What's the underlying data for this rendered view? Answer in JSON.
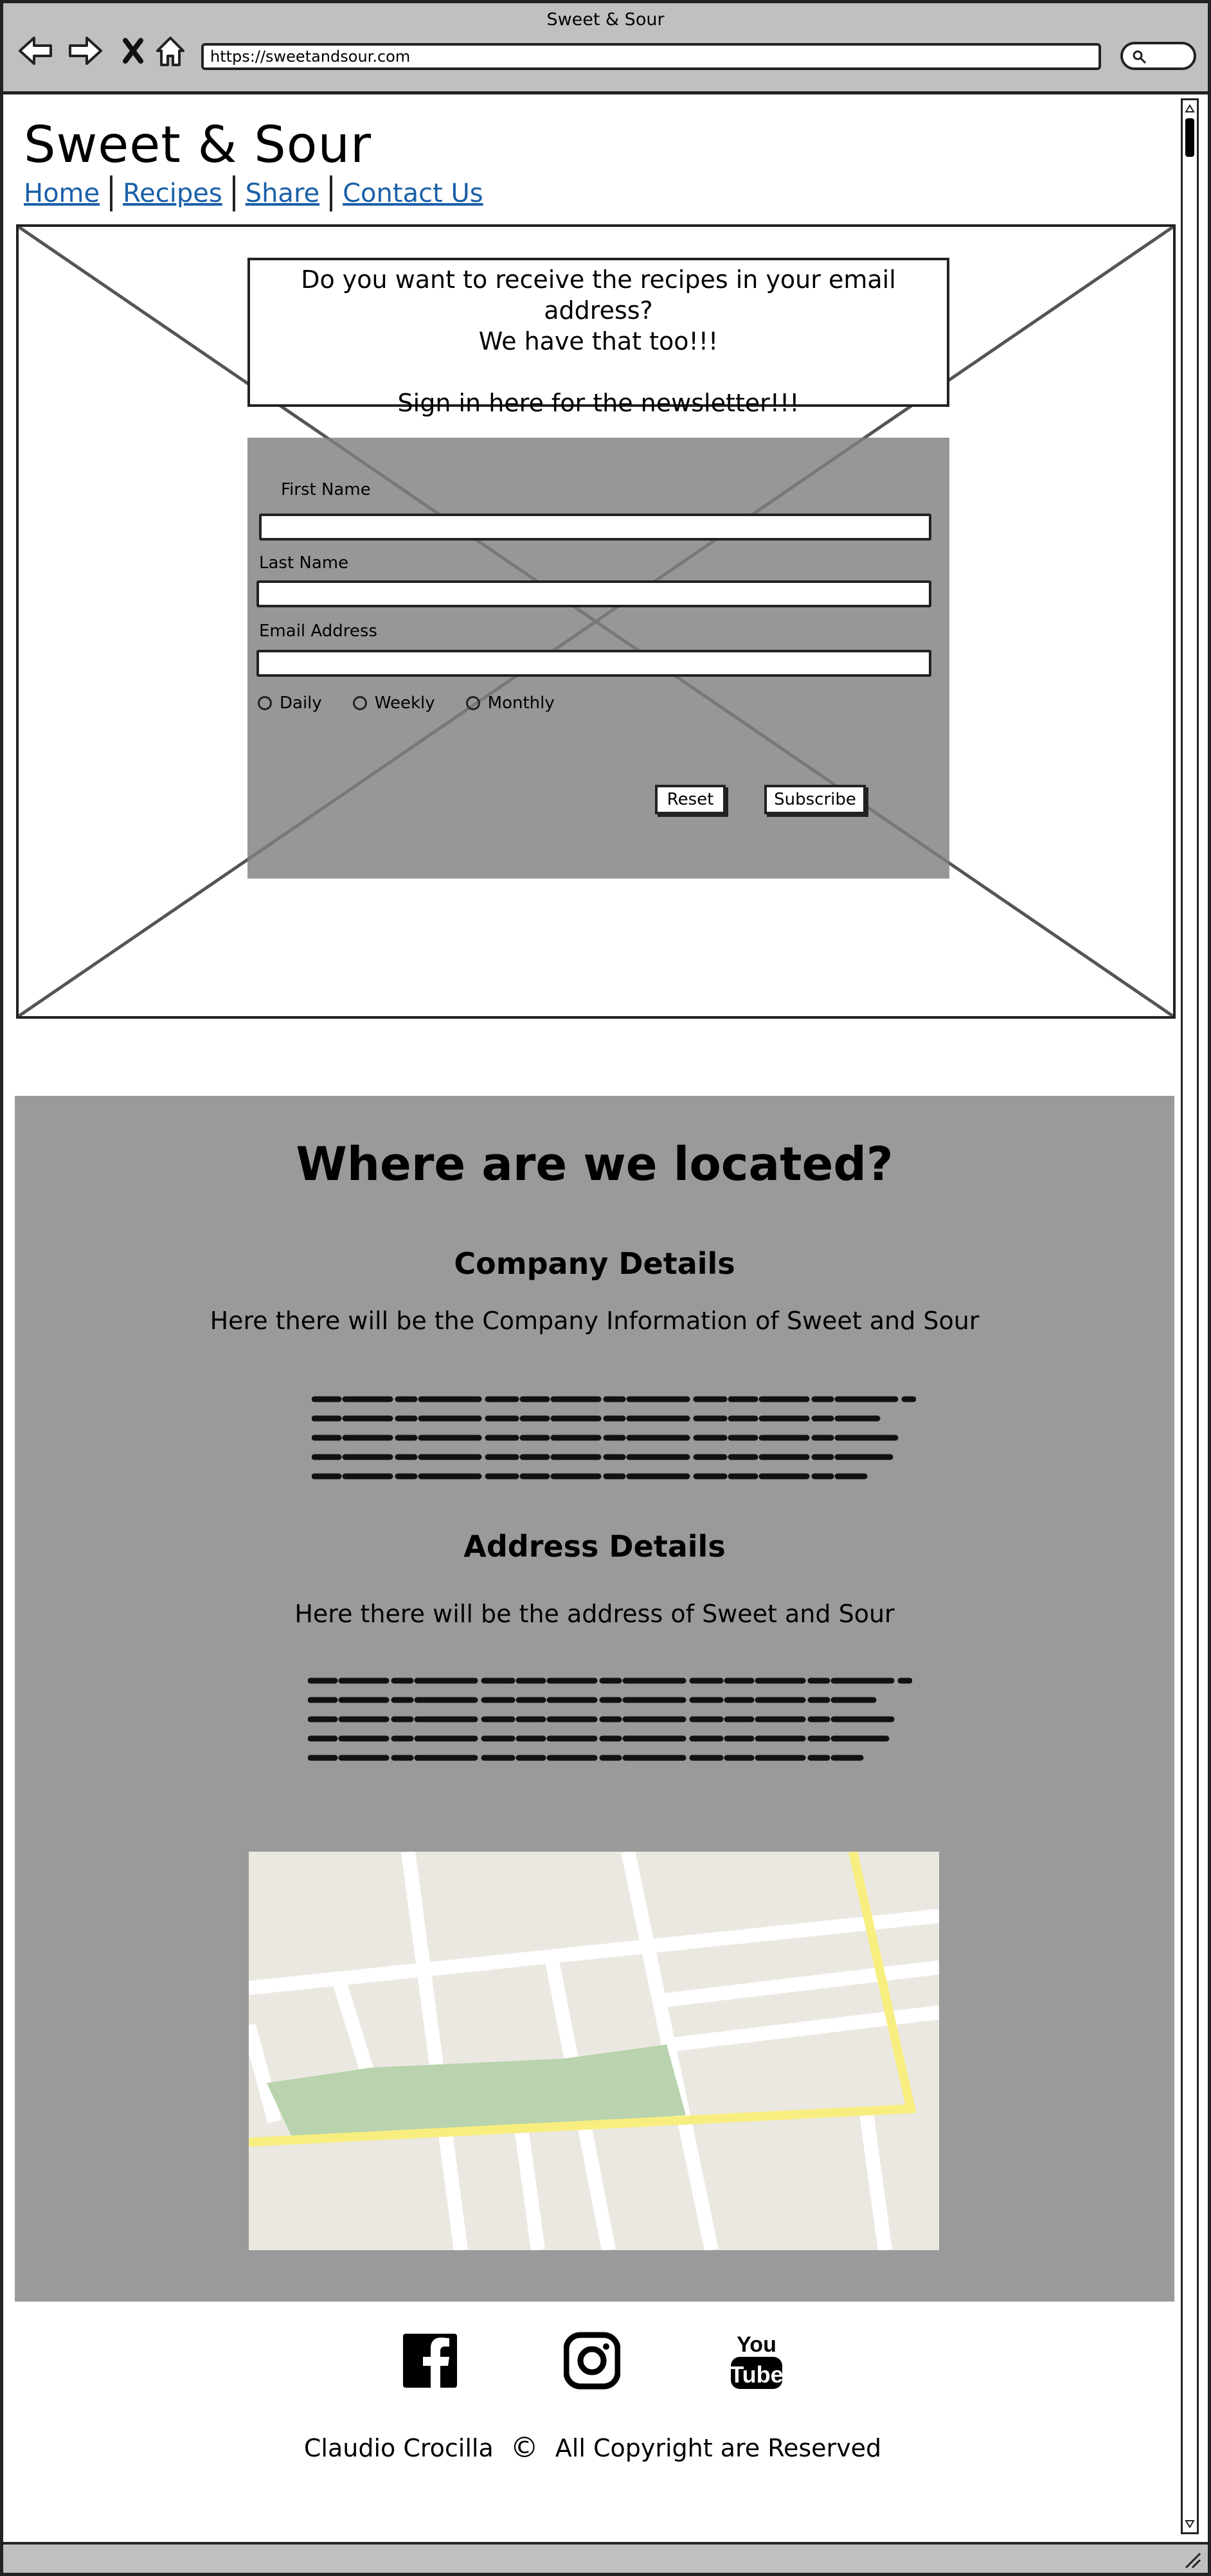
{
  "window": {
    "title": "Sweet & Sour",
    "url": "https://sweetandsour.com"
  },
  "site": {
    "title": "Sweet & Sour",
    "nav": [
      "Home",
      "Recipes",
      "Share",
      "Contact Us"
    ]
  },
  "newsletter": {
    "line1": "Do you want to receive the recipes in your email address?",
    "line2": "We have that too!!!",
    "line3": "Sign in here for the newsletter!!!",
    "first_name_label": "First Name",
    "last_name_label": "Last Name",
    "email_label": "Email Address",
    "frequency_options": [
      "Daily",
      "Weekly",
      "Monthly"
    ],
    "reset_label": "Reset",
    "subscribe_label": "Subscribe"
  },
  "location": {
    "title": "Where are we located?",
    "company_title": "Company Details",
    "company_text": "Here there will be the Company Information of Sweet and Sour",
    "address_title": "Address Details",
    "address_text": "Here there will be the address of Sweet and Sour"
  },
  "footer": {
    "author": "Claudio Crocilla",
    "copyright_symbol": "©",
    "rights": "All Copyright are Reserved",
    "social_icons": [
      "facebook-icon",
      "instagram-icon",
      "youtube-icon"
    ]
  },
  "colors": {
    "link": "#1a5fa8",
    "chrome": "#c0c0c0",
    "panel_gray": "#9a9a9a",
    "map_road_yellow": "#f7ee7f",
    "map_park_green": "#b8d3ad"
  }
}
